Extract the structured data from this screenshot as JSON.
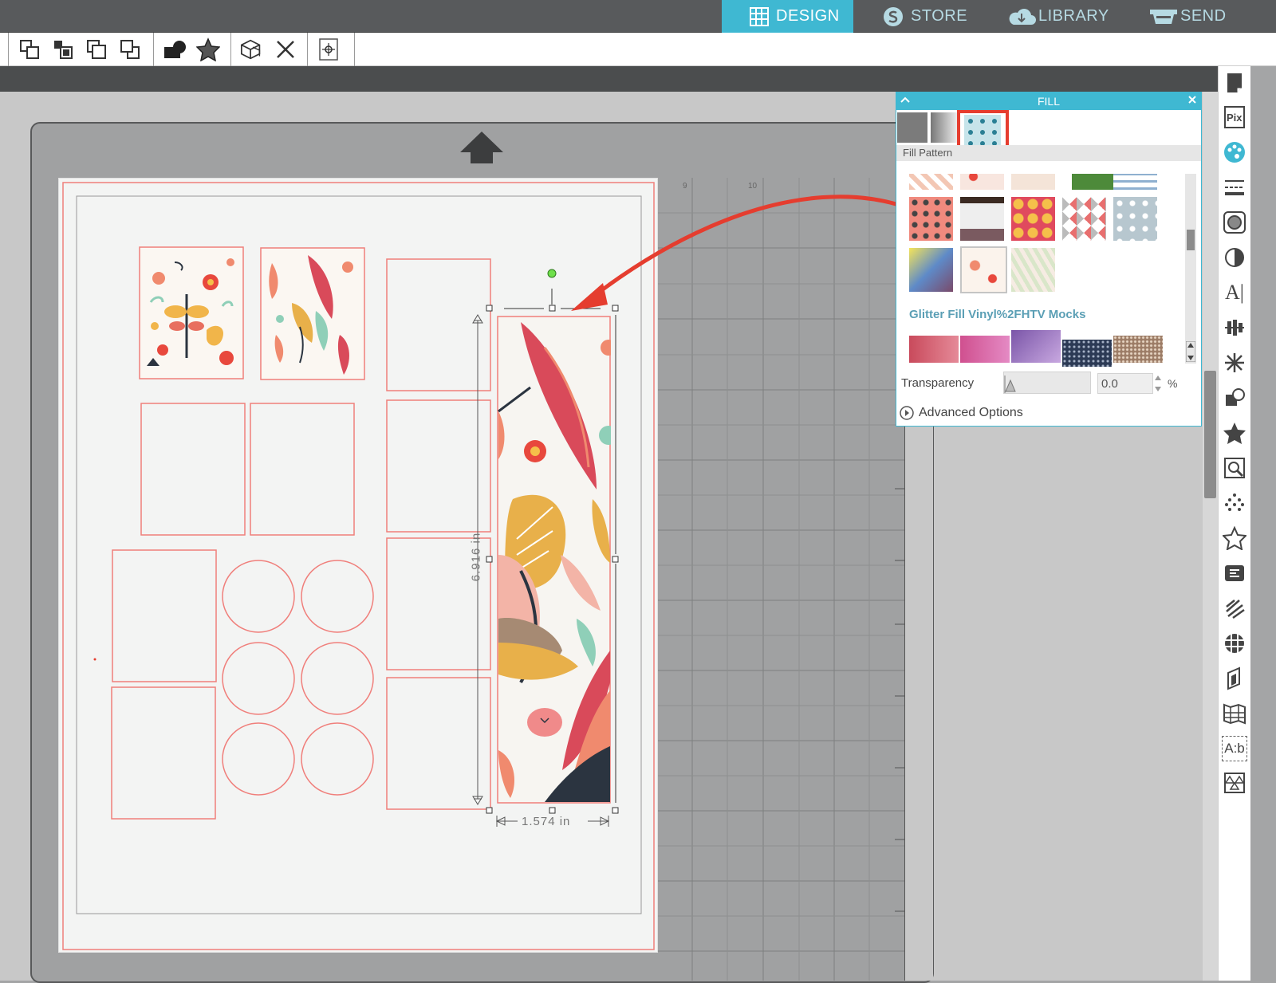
{
  "topnav": {
    "tabs": [
      {
        "label": "DESIGN",
        "icon": "grid-icon",
        "active": true
      },
      {
        "label": "STORE",
        "icon": "store-icon",
        "active": false
      },
      {
        "label": "LIBRARY",
        "icon": "cloud-icon",
        "active": false
      },
      {
        "label": "SEND",
        "icon": "cutter-icon",
        "active": false
      }
    ]
  },
  "toolbar": {
    "groups": [
      [
        "bring-to-front-icon",
        "bring-forward-icon",
        "send-backward-icon",
        "send-to-back-icon"
      ],
      [
        "group-shapes-icon",
        "star-shape-icon"
      ],
      [
        "ungroup-icon",
        "delete-icon"
      ],
      [
        "center-to-page-icon"
      ]
    ]
  },
  "canvas": {
    "ruler_ticks": [
      "9",
      "10"
    ],
    "height_label": "6.916 in",
    "width_label": "1.574 in"
  },
  "fill_panel": {
    "title": "FILL",
    "tabs": [
      "fill-color",
      "fill-gradient",
      "fill-pattern"
    ],
    "section_label": "Fill Pattern",
    "category_label": "Glitter Fill Vinyl%2FHTV Mocks",
    "transparency_label": "Transparency",
    "transparency_value": "0.0",
    "percent_sign": "%",
    "advanced_label": "Advanced Options"
  },
  "right_rail": {
    "icons": [
      "page-setup-icon",
      "pixscan-icon",
      "fill-panel-icon",
      "line-style-icon",
      "image-effects-icon",
      "transform-icon",
      "text-style-icon",
      "align-icon",
      "replicate-icon",
      "modify-icon",
      "offset-icon",
      "trace-icon",
      "sketch-icon",
      "star-outline-icon",
      "text-to-path-icon",
      "knife-icon",
      "layers-icon",
      "page-tabs-icon",
      "library-grid-icon",
      "text-ab-icon",
      "pattern-icon"
    ],
    "pix_label": "Pix",
    "text_a_label": "A|",
    "ab_label": "A:b"
  },
  "colors": {
    "accent": "#3fb8d2",
    "cut_line": "#f07f7b",
    "highlight": "#e53d2f"
  }
}
